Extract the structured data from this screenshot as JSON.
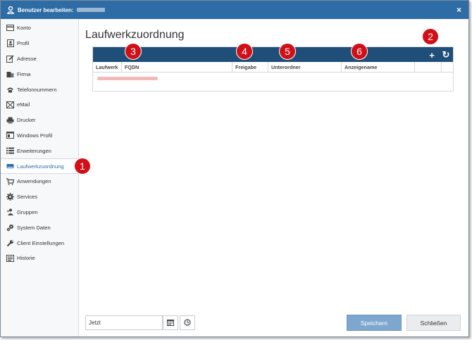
{
  "window": {
    "title": "Benutzer bearbeiten:",
    "close_glyph": "×"
  },
  "sidebar": {
    "items": [
      {
        "label": "Konto",
        "icon": "credit-card-icon"
      },
      {
        "label": "Profil",
        "icon": "id-card-icon"
      },
      {
        "label": "Adresse",
        "icon": "edit-icon"
      },
      {
        "label": "Firma",
        "icon": "building-icon"
      },
      {
        "label": "Telefonnummern",
        "icon": "phone-icon"
      },
      {
        "label": "eMail",
        "icon": "envelope-icon"
      },
      {
        "label": "Drucker",
        "icon": "printer-icon"
      },
      {
        "label": "Windows Profil",
        "icon": "window-icon"
      },
      {
        "label": "Erweiterungen",
        "icon": "list-icon"
      },
      {
        "label": "Laufwerkzuordnung",
        "icon": "drive-icon",
        "active": true
      },
      {
        "label": "Anwendungen",
        "icon": "cart-icon"
      },
      {
        "label": "Services",
        "icon": "gear-icon"
      },
      {
        "label": "Gruppen",
        "icon": "users-icon"
      },
      {
        "label": "System Daten",
        "icon": "cogs-icon"
      },
      {
        "label": "Client Einstellungen",
        "icon": "wrench-icon"
      },
      {
        "label": "Historie",
        "icon": "history-icon"
      }
    ]
  },
  "main": {
    "title": "Laufwerkzuordnung",
    "grid": {
      "columns": [
        "Laufwerk",
        "FQDN",
        "Freigabe",
        "Unterordner",
        "Anzeigename"
      ],
      "add_glyph": "+",
      "refresh_glyph": "↻"
    }
  },
  "badges": [
    "1",
    "2",
    "3",
    "4",
    "5",
    "6"
  ],
  "footer": {
    "date_value": "Jetzt",
    "save_label": "Speichern",
    "close_label": "Schließen"
  },
  "colors": {
    "titlebar": "#2d6ca5",
    "grid_toolbar": "#1f4f79",
    "badge": "#d10f17",
    "save_button": "#7ea7cf"
  }
}
